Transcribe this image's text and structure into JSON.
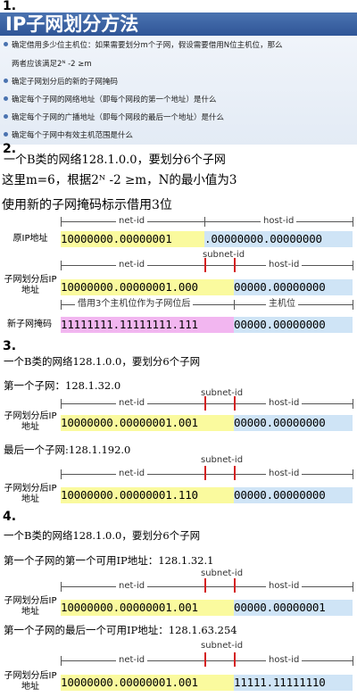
{
  "section_numbers": [
    "1.",
    "2.",
    "3.",
    "4."
  ],
  "panel1": {
    "title": "IP子网划分方法",
    "bullets": [
      "确定借用多少位主机位：如果需要划分m个子网，假设需要借用N位主机位，那么",
      "两者应该满足2ᴺ -2 ≥m",
      "确定子网划分后的新的子网掩码",
      "确定每个子网的网络地址（即每个网段的第一个地址）是什么",
      "确定每个子网的广播地址（即每个网段的最后一个地址）是什么",
      "确定每个子网中有效主机范围是什么"
    ]
  },
  "panel2": {
    "line1": "一个B类的网络128.1.0.0，要划分6个子网",
    "line2": "这里m=6，根据2ᴺ -2 ≥m，N的最小值为3",
    "line3": "使用新的子网掩码标示借用3位",
    "net_id": "net-id",
    "host_id": "host-id",
    "subnet_id": "subnet-id",
    "row1_label": "原IP地址",
    "row1_net": "10000000.00000001",
    "row1_host": ".00000000.00000000",
    "row2_label": "子网划分后IP地址",
    "row2_net": "10000000.00000001",
    "row2_sub": ".000",
    "row2_host": "00000.00000000",
    "borrow_label": "借用3个主机位作为子网位后",
    "host_bits_label": "主机位",
    "mask_label": "新子网掩码",
    "mask_net": "11111111.11111111",
    "mask_sub": ".111",
    "mask_host": "00000.00000000"
  },
  "panel3": {
    "line1": "一个B类的网络128.1.0.0，要划分6个子网",
    "first_label": "第一个子网：128.1.32.0",
    "last_label": "最后一个子网:128.1.192.0",
    "net_id": "net-id",
    "host_id": "host-id",
    "subnet_id": "subnet-id",
    "row_label": "子网划分后IP地址",
    "a_net": "10000000.00000001",
    "a_sub": ".001",
    "a_host": "00000.00000000",
    "b_net": "10000000.00000001",
    "b_sub": ".110",
    "b_host": "00000.00000000"
  },
  "panel4": {
    "line1": "一个B类的网络128.1.0.0，要划分6个子网",
    "first_label": "第一个子网的第一个可用IP地址：128.1.32.1",
    "last_label": "第一个子网的最后一个可用IP地址：128.1.63.254",
    "net_id": "net-id",
    "host_id": "host-id",
    "subnet_id": "subnet-id",
    "row_label": "子网划分后IP地址",
    "a_net": "10000000.00000001",
    "a_sub": ".001",
    "a_host": "00000.00000001",
    "b_net": "10000000.00000001",
    "b_sub": ".001",
    "b_host": "11111.11111110"
  }
}
